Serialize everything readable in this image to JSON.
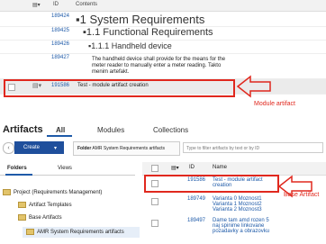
{
  "module": {
    "header": {
      "id": "ID",
      "contents": "Contents"
    },
    "rows": [
      {
        "id": "189424",
        "text": "1 System Requirements"
      },
      {
        "id": "189425",
        "text": "1.1 Functional Requirements"
      },
      {
        "id": "189426",
        "text": "1.1.1 Handheld device"
      },
      {
        "id": "189427",
        "text": "The handheld device shall provide for the means for the meter reader to manually enter a meter reading. Takto menim artefakt."
      },
      {
        "id": "191586",
        "text": "Test - module artifact creation"
      }
    ],
    "annotation": "Module artifact"
  },
  "artifacts_page": {
    "title": "Artifacts",
    "tabs": [
      "All",
      "Modules",
      "Collections"
    ],
    "create_label": "Create",
    "folder_prefix": "Folder",
    "folder_name": "AMR System Requirements artifacts",
    "filter_placeholder": "Type to filter artifacts by text or by ID",
    "left_tabs": [
      "Folders",
      "Views"
    ],
    "tree": [
      "Project (Requirements Management)",
      "Artifact Templates",
      "Base Artifacts",
      "AMR System Requirements artifacts"
    ],
    "grid_header": {
      "id": "ID",
      "name": "Name"
    },
    "grid_rows": [
      {
        "id": "191586",
        "name": "Test - module artifact creation"
      },
      {
        "id": "189749",
        "name": "Varianta 0 Moznost1 Varianta 1 Moznost2 Varianta 2 Moznost3"
      },
      {
        "id": "189497",
        "name": "Dame tam amd rozen 5 naj spinime linkovane pozadavky a obrazovku"
      }
    ],
    "annotation": "Base Artifact"
  },
  "colors": {
    "accent": "#1f4f9c",
    "annotation": "#e0281e",
    "link": "#1e5aa8"
  }
}
